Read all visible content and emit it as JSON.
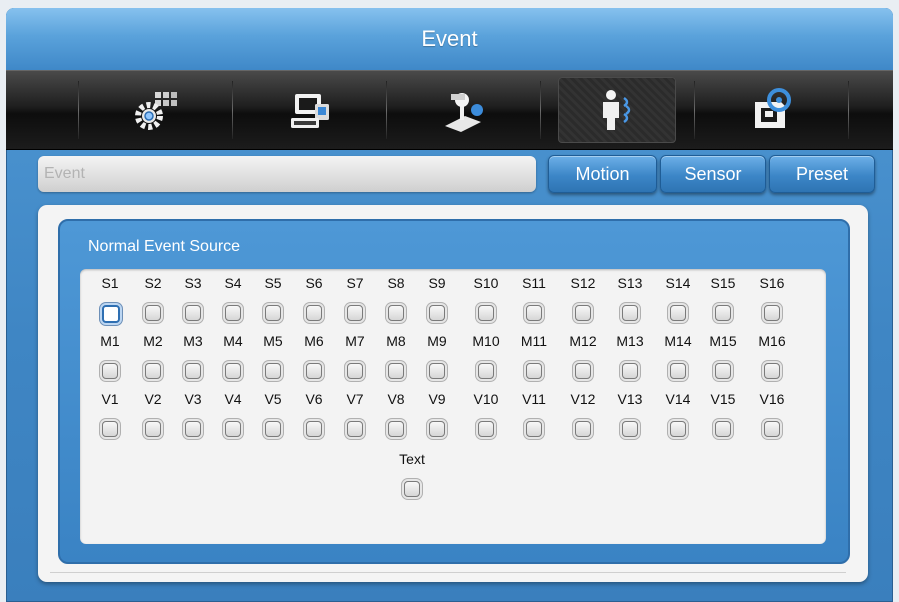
{
  "window": {
    "title": "Event"
  },
  "toolbar": {
    "items": [
      {
        "name": "settings-grid-icon",
        "active": false
      },
      {
        "name": "computer-display-icon",
        "active": false
      },
      {
        "name": "joystick-control-icon",
        "active": false
      },
      {
        "name": "person-motion-icon",
        "active": true
      },
      {
        "name": "storage-disc-icon",
        "active": false
      }
    ]
  },
  "event_field": {
    "placeholder": "Event"
  },
  "tabs": [
    "Motion",
    "Sensor",
    "Preset"
  ],
  "panel": {
    "title": "Normal Event Source"
  },
  "sources": {
    "rows": [
      [
        "S1",
        "S2",
        "S3",
        "S4",
        "S5",
        "S6",
        "S7",
        "S8",
        "S9",
        "S10",
        "S11",
        "S12",
        "S13",
        "S14",
        "S15",
        "S16"
      ],
      [
        "M1",
        "M2",
        "M3",
        "M4",
        "M5",
        "M6",
        "M7",
        "M8",
        "M9",
        "M10",
        "M11",
        "M12",
        "M13",
        "M14",
        "M15",
        "M16"
      ],
      [
        "V1",
        "V2",
        "V3",
        "V4",
        "V5",
        "V6",
        "V7",
        "V8",
        "V9",
        "V10",
        "V11",
        "V12",
        "V13",
        "V14",
        "V15",
        "V16"
      ]
    ],
    "focused": "S1",
    "text_label": "Text"
  },
  "colors": {
    "accent": "#3f86c4",
    "title_bar": "#5aa2db",
    "icon_bar": "#1f1f1f"
  }
}
